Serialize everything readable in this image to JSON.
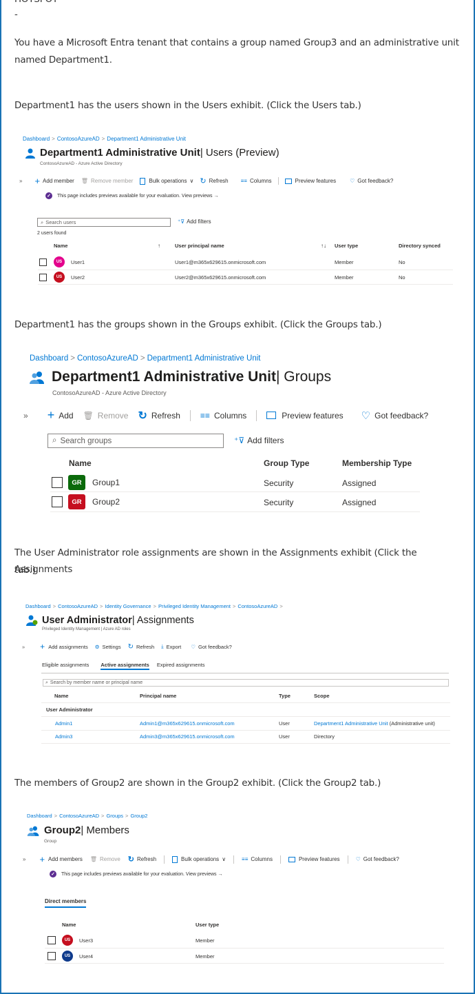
{
  "colors": {
    "frame": "#1a73b5",
    "link": "#0078d4",
    "user1_avatar": "#e3008c",
    "red_avatar": "#c50f1f",
    "green_avatar": "#0b6a0b",
    "blue_avatar": "#0f3b8c"
  },
  "question": {
    "top_fragment": "HOTSPOT",
    "dash": "-",
    "p1_line1": "You have a Microsoft Entra tenant that contains a group named Group3 and an administrative unit",
    "p1_line2": "named Department1.",
    "p2": "Department1 has the users shown in the Users exhibit. (Click the Users tab.)",
    "p3": "Department1 has the groups shown in the Groups exhibit. (Click the Groups tab.)",
    "p4_line1": "The User Administrator role assignments are shown in the Assignments exhibit (Click the Assignments",
    "p4_line2": "tab.)",
    "p5": "The members of Group2 are shown in the Group2 exhibit. (Click the Group2 tab.)"
  },
  "users_exhibit": {
    "breadcrumb": [
      "Dashboard",
      "ContosoAzureAD",
      "Department1 Administrative Unit"
    ],
    "title_main": "Department1 Administrative Unit",
    "title_rest": " | Users (Preview)",
    "subtitle": "ContosoAzureAD - Azure Active Directory",
    "toolbar": {
      "add": "Add member",
      "remove": "Remove member",
      "bulk": "Bulk operations",
      "refresh": "Refresh",
      "columns": "Columns",
      "preview": "Preview features",
      "feedback": "Got feedback?"
    },
    "notice": "This page includes previews available for your evaluation. View previews →",
    "search_placeholder": "Search users",
    "add_filters": "Add filters",
    "count": "2 users found",
    "headers": {
      "name": "Name",
      "upn": "User principal name",
      "type": "User type",
      "synced": "Directory synced"
    },
    "rows": [
      {
        "initials": "US",
        "name": "User1",
        "upn": "User1@m365x629615.onmicrosoft.com",
        "type": "Member",
        "synced": "No"
      },
      {
        "initials": "US",
        "name": "User2",
        "upn": "User2@m365x629615.onmicrosoft.com",
        "type": "Member",
        "synced": "No"
      }
    ]
  },
  "groups_exhibit": {
    "breadcrumb": [
      "Dashboard",
      "ContosoAzureAD",
      "Department1 Administrative Unit"
    ],
    "title_main": "Department1 Administrative Unit",
    "title_rest": " | Groups",
    "subtitle": "ContosoAzureAD - Azure Active Directory",
    "toolbar": {
      "add": "Add",
      "remove": "Remove",
      "refresh": "Refresh",
      "columns": "Columns",
      "preview": "Preview features",
      "feedback": "Got feedback?"
    },
    "search_placeholder": "Search groups",
    "add_filters": "Add filters",
    "headers": {
      "name": "Name",
      "group_type": "Group Type",
      "membership": "Membership Type"
    },
    "rows": [
      {
        "initials": "GR",
        "name": "Group1",
        "group_type": "Security",
        "membership": "Assigned"
      },
      {
        "initials": "GR",
        "name": "Group2",
        "group_type": "Security",
        "membership": "Assigned"
      }
    ]
  },
  "assignments_exhibit": {
    "breadcrumb": [
      "Dashboard",
      "ContosoAzureAD",
      "Identity Governance",
      "Privileged Identity Management",
      "ContosoAzureAD"
    ],
    "title_main": "User Administrator",
    "title_rest": " | Assignments",
    "subtitle": "Privileged Identity Management | Azure AD roles",
    "toolbar": {
      "add": "Add assignments",
      "settings": "Settings",
      "refresh": "Refresh",
      "export": "Export",
      "feedback": "Got feedback?"
    },
    "tabs": [
      "Eligible assignments",
      "Active assignments",
      "Expired assignments"
    ],
    "search_placeholder": "Search by member name or principal name",
    "headers": {
      "name": "Name",
      "principal": "Principal name",
      "type": "Type",
      "scope": "Scope"
    },
    "group_label": "User Administrator",
    "rows": [
      {
        "name": "Admin1",
        "principal": "Admin1@m365x629615.onmicrosoft.com",
        "type": "User",
        "scope_link": "Department1 Administrative Unit",
        "scope_suffix": " (Administrative unit)"
      },
      {
        "name": "Admin3",
        "principal": "Admin3@m365x629615.onmicrosoft.com",
        "type": "User",
        "scope_link": "",
        "scope_suffix": "Directory"
      }
    ]
  },
  "group2_exhibit": {
    "breadcrumb": [
      "Dashboard",
      "ContosoAzureAD",
      "Groups",
      "Group2"
    ],
    "title_main": "Group2",
    "title_rest": " | Members",
    "subtitle": "Group",
    "toolbar": {
      "add": "Add members",
      "remove": "Remove",
      "refresh": "Refresh",
      "bulk": "Bulk operations",
      "columns": "Columns",
      "preview": "Preview features",
      "feedback": "Got feedback?"
    },
    "notice": "This page includes previews available for your evaluation. View previews →",
    "tab": "Direct members",
    "headers": {
      "name": "Name",
      "type": "User type"
    },
    "rows": [
      {
        "initials": "US",
        "name": "User3",
        "type": "Member"
      },
      {
        "initials": "US",
        "name": "User4",
        "type": "Member"
      }
    ]
  }
}
